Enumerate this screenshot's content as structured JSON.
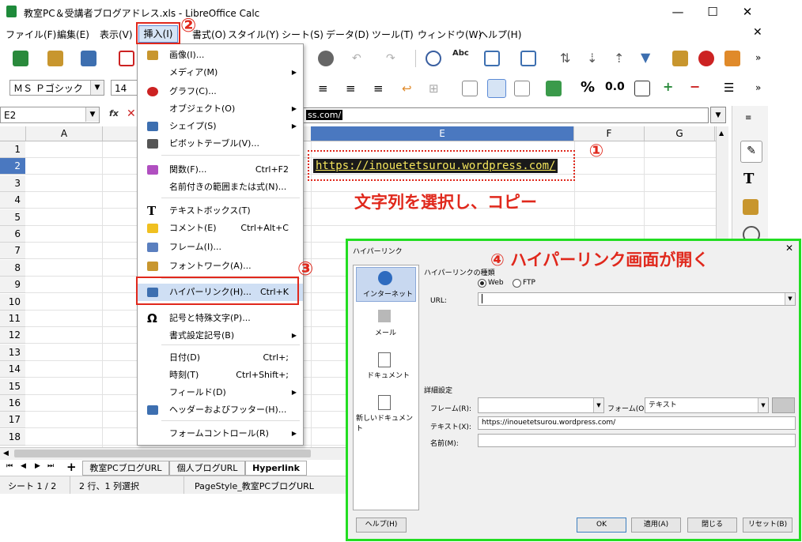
{
  "window": {
    "title": "教室PC＆受講者ブログアドレス.xls - LibreOffice Calc",
    "minimize": "—",
    "maximize": "☐",
    "close": "✕",
    "doc_close": "✕"
  },
  "menubar": [
    "ファイル(F)",
    "編集(E)",
    "表示(V)",
    "挿入(I)",
    "書式(O)",
    "スタイル(Y)",
    "シート(S)",
    "データ(D)",
    "ツール(T)",
    "ウィンドウ(W)",
    "ヘルプ(H)"
  ],
  "formatting": {
    "font_name": "ＭＳ Ｐゴシック",
    "font_size": "14",
    "percent": "%",
    "decimal": "0.0"
  },
  "formula_bar": {
    "name_box": "E2",
    "content_visible": "ss.com/"
  },
  "columns": [
    "A",
    "E",
    "F",
    "G"
  ],
  "rows": [
    "1",
    "2",
    "3",
    "4",
    "5",
    "6",
    "7",
    "8",
    "9",
    "10",
    "11",
    "12",
    "13",
    "14",
    "15",
    "16",
    "17",
    "18"
  ],
  "cell_e2": "https://inouetetsurou.wordpress.com/",
  "sheet_tabs": [
    "教室PCブログURL",
    "個人ブログURL",
    "Hyperlink"
  ],
  "status_bar": {
    "sheet": "シート 1 / 2",
    "selection": "2 行、1 列選択",
    "page_style": "PageStyle_教室PCブログURL"
  },
  "insert_menu": {
    "items": [
      {
        "label": "画像(I)...",
        "shortcut": "",
        "sub": false
      },
      {
        "label": "メディア(M)",
        "shortcut": "",
        "sub": true
      },
      {
        "label": "グラフ(C)...",
        "shortcut": "",
        "sub": false
      },
      {
        "label": "オブジェクト(O)",
        "shortcut": "",
        "sub": true
      },
      {
        "label": "シェイプ(S)",
        "shortcut": "",
        "sub": true
      },
      {
        "label": "ピボットテーブル(V)...",
        "shortcut": "",
        "sub": false
      },
      {
        "label": "関数(F)...",
        "shortcut": "Ctrl+F2",
        "sub": false
      },
      {
        "label": "名前付きの範囲または式(N)...",
        "shortcut": "",
        "sub": false
      },
      {
        "label": "テキストボックス(T)",
        "shortcut": "",
        "sub": false
      },
      {
        "label": "コメント(E)",
        "shortcut": "Ctrl+Alt+C",
        "sub": false
      },
      {
        "label": "フレーム(I)...",
        "shortcut": "",
        "sub": false
      },
      {
        "label": "フォントワーク(A)...",
        "shortcut": "",
        "sub": false
      },
      {
        "label": "ハイパーリンク(H)...",
        "shortcut": "Ctrl+K",
        "sub": false
      },
      {
        "label": "記号と特殊文字(P)...",
        "shortcut": "",
        "sub": false
      },
      {
        "label": "書式設定記号(B)",
        "shortcut": "",
        "sub": true
      },
      {
        "label": "日付(D)",
        "shortcut": "Ctrl+;",
        "sub": false
      },
      {
        "label": "時刻(T)",
        "shortcut": "Ctrl+Shift+;",
        "sub": false
      },
      {
        "label": "フィールド(D)",
        "shortcut": "",
        "sub": true
      },
      {
        "label": "ヘッダーおよびフッター(H)...",
        "shortcut": "",
        "sub": false
      },
      {
        "label": "フォームコントロール(R)",
        "shortcut": "",
        "sub": true
      }
    ]
  },
  "annotations": {
    "n1": "①",
    "n2": "②",
    "n3": "③",
    "instruction": "文字列を選択し、コピー",
    "dialog_note": "④ ハイパーリンク画面が開く"
  },
  "hyperlink_dialog": {
    "title": "ハイパーリンク",
    "close": "✕",
    "sidebar": [
      "インターネット",
      "メール",
      "ドキュメント",
      "新しいドキュメント"
    ],
    "type_group": "ハイパーリンクの種類",
    "radio_web": "Web",
    "radio_ftp": "FTP",
    "url_label": "URL:",
    "url_value": "",
    "detail_group": "詳細設定",
    "frame_label": "フレーム(R):",
    "frame_value": "",
    "form_label": "フォーム(O):",
    "form_value": "テキスト",
    "text_label": "テキスト(X):",
    "text_value": "https://inouetetsurou.wordpress.com/",
    "name_label": "名前(M):",
    "name_value": "",
    "help": "ヘルプ(H)",
    "ok": "OK",
    "apply": "適用(A)",
    "close_btn": "閉じる",
    "reset": "リセット(B)"
  },
  "colors": {
    "accent_red": "#e0281c",
    "dialog_border": "#22dd22",
    "selection_blue": "#4a78c0"
  }
}
